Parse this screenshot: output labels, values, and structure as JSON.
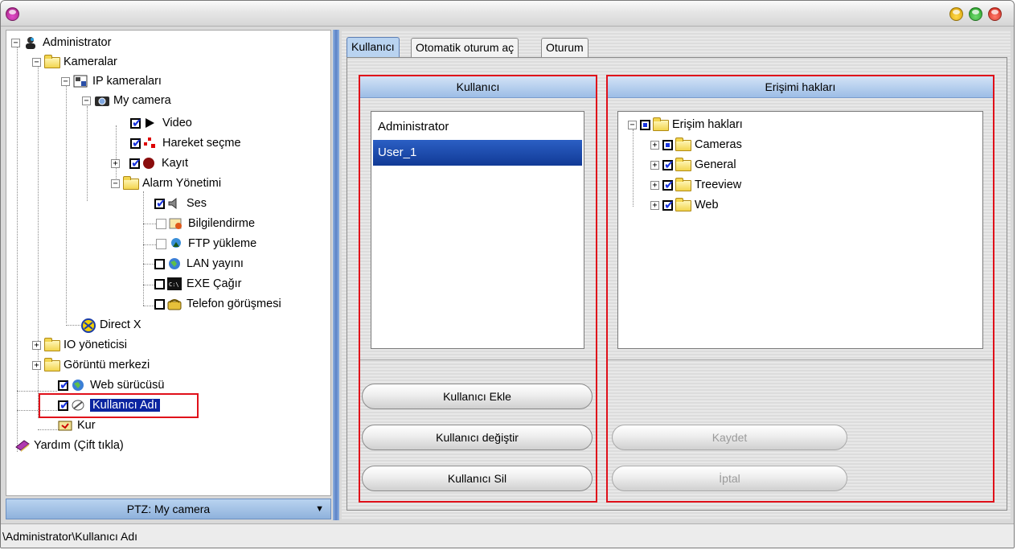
{
  "window": {
    "colors": {
      "selection": "#0b24a0",
      "highlight_red": "#e0101a",
      "accent_blue": "#9cbde6"
    }
  },
  "tree": {
    "administrator": "Administrator",
    "kameralar": "Kameralar",
    "ip_kameralari": "IP kameraları",
    "my_camera": "My camera",
    "video": "Video",
    "hareket": "Hareket seçme",
    "kayit": "Kayıt",
    "alarm": "Alarm Yönetimi",
    "ses": "Ses",
    "bilgilendirme": "Bilgilendirme",
    "ftp": "FTP yükleme",
    "lan": "LAN yayını",
    "exe": "EXE Çağır",
    "telefon": "Telefon görüşmesi",
    "directx": "Direct X",
    "io": "IO yöneticisi",
    "goruntu": "Görüntü merkezi",
    "web": "Web sürücüsü",
    "kullanici_adi": "Kullanıcı Adı",
    "kur": "Kur",
    "yardim": "Yardım (Çift tıkla)"
  },
  "ptz": {
    "label": "PTZ: My camera"
  },
  "status": {
    "path": "\\Administrator\\Kullanıcı Adı"
  },
  "tabs": [
    "Kullanıcı",
    "Otomatik oturum aç",
    "Oturum"
  ],
  "users_panel": {
    "header": "Kullanıcı",
    "users": [
      "Administrator",
      "User_1"
    ],
    "selected": "User_1",
    "add_label": "Kullanıcı Ekle",
    "edit_label": "Kullanıcı değiştir",
    "delete_label": "Kullanıcı Sil"
  },
  "rights_panel": {
    "header": "Erişimi hakları",
    "root": "Erişim hakları",
    "items": [
      "Cameras",
      "General",
      "Treeview",
      "Web"
    ],
    "save_label": "Kaydet",
    "cancel_label": "İptal"
  }
}
